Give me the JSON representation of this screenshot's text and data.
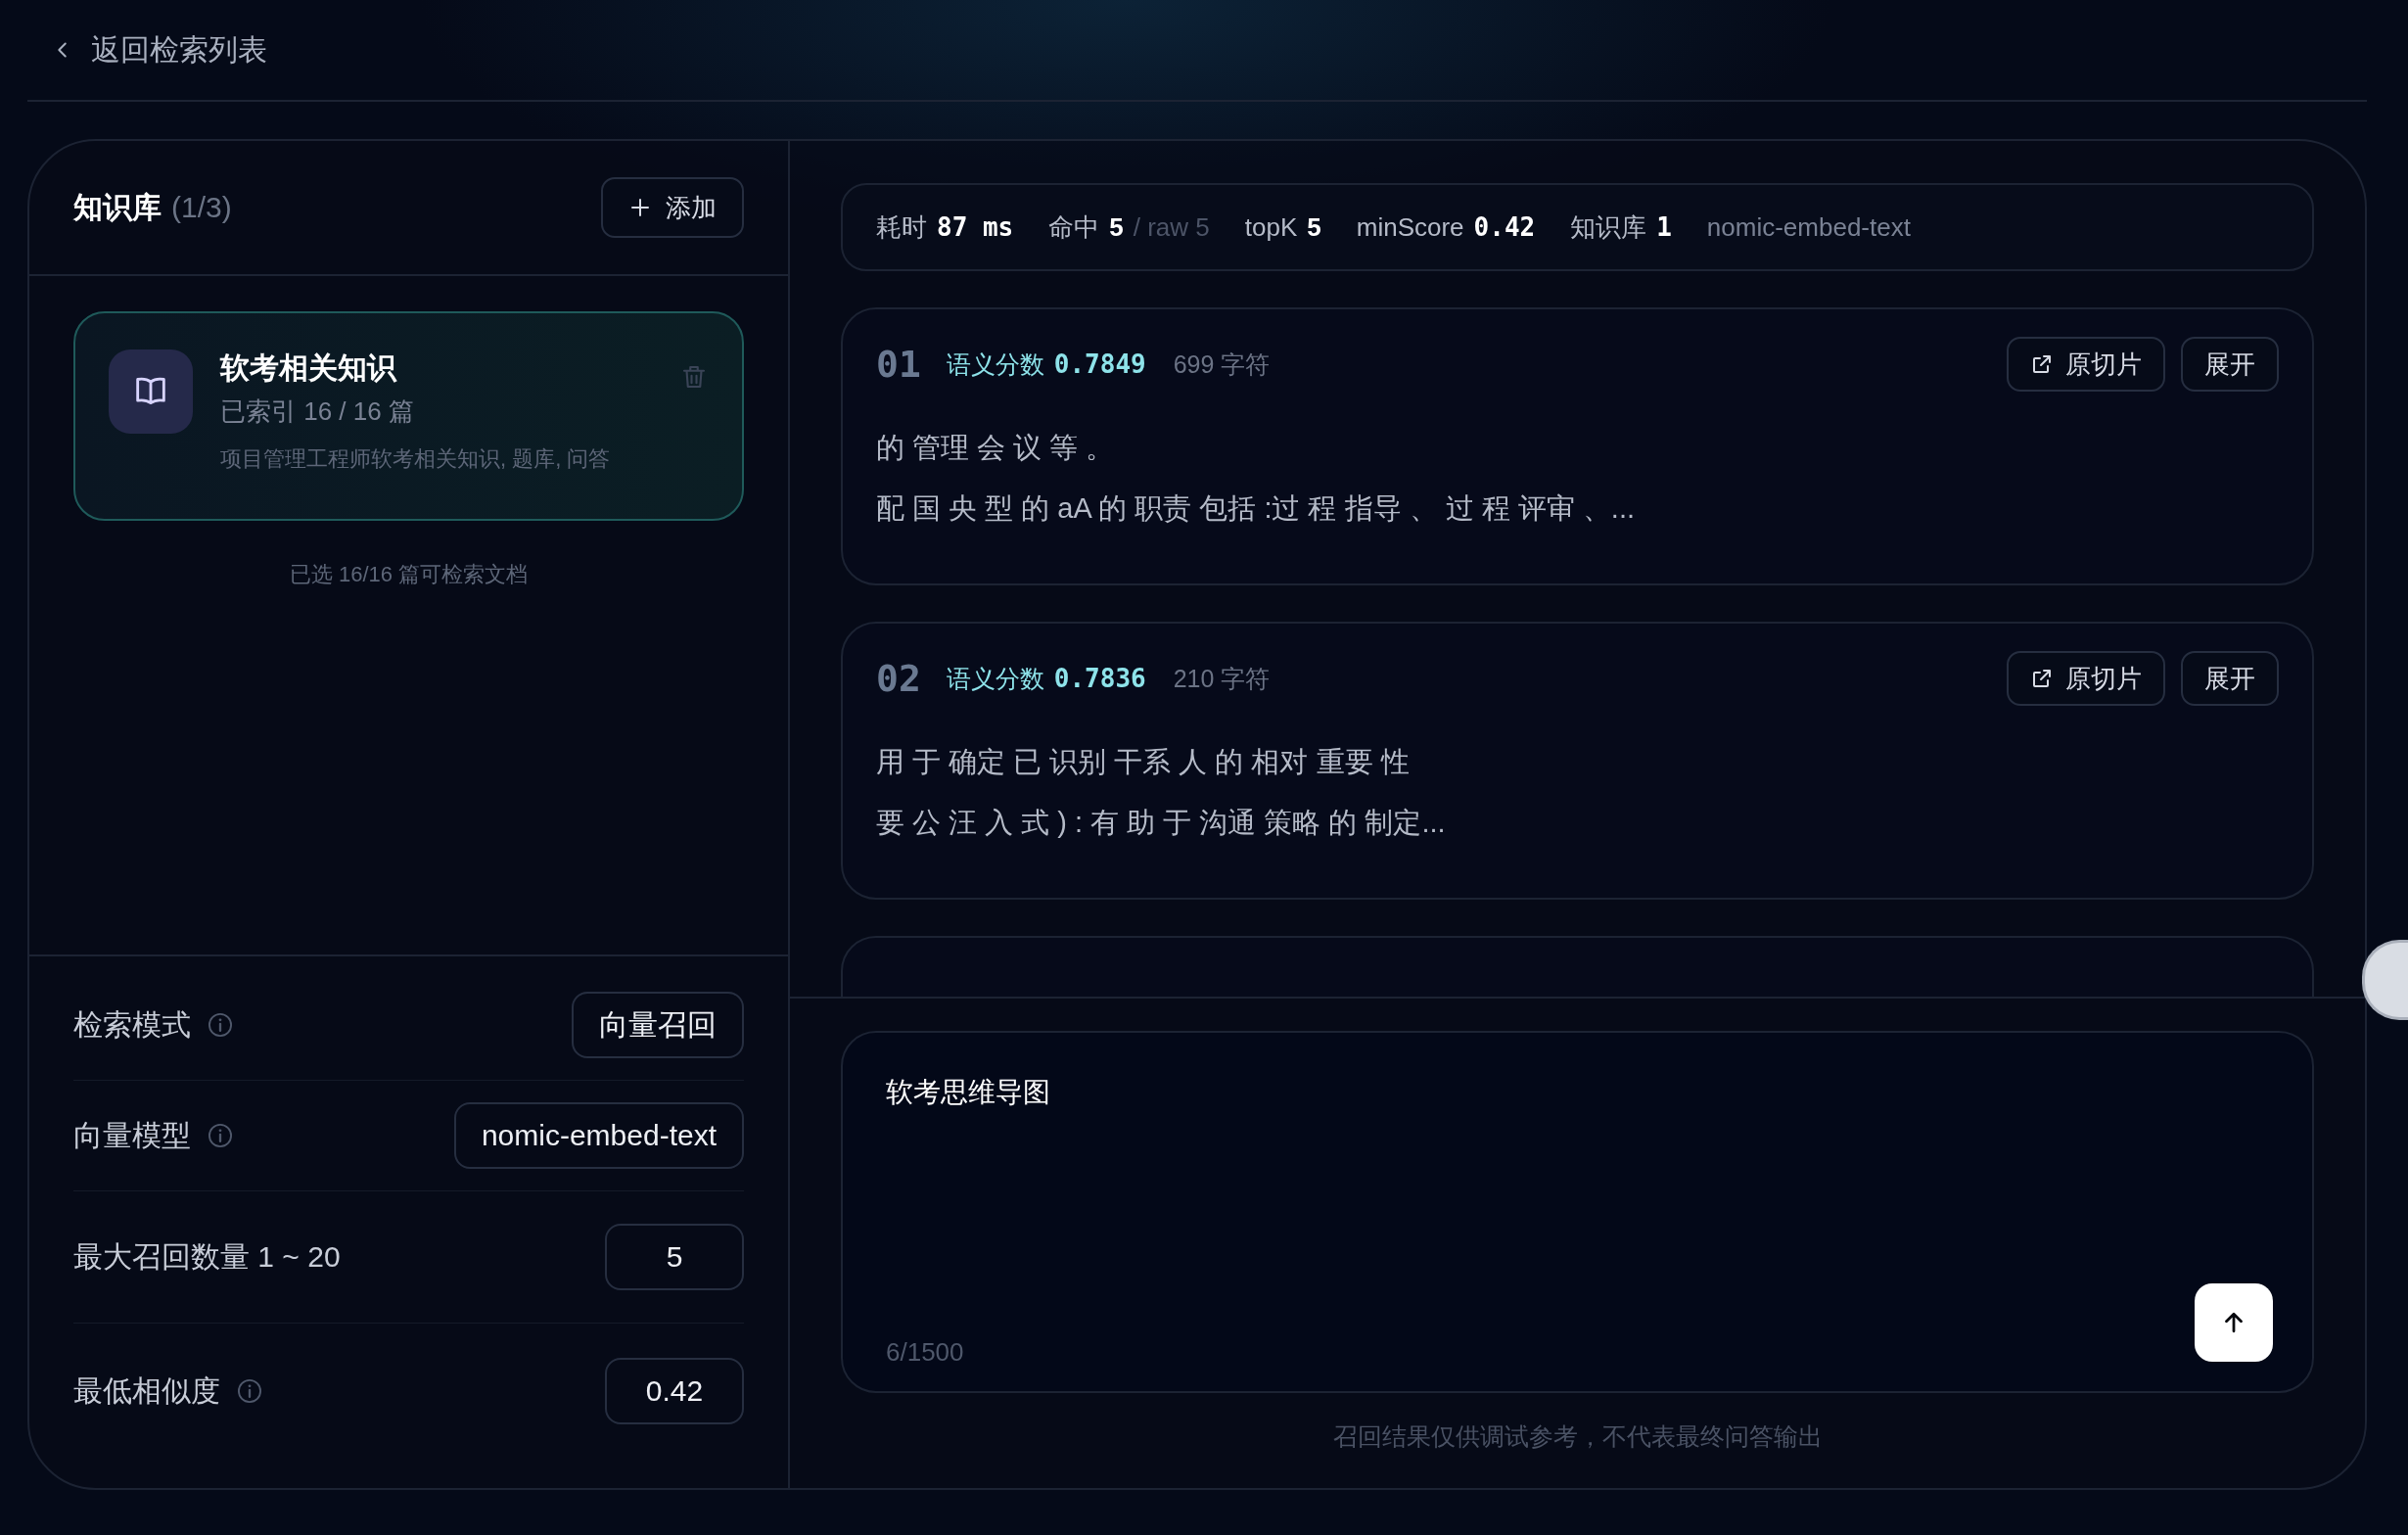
{
  "back_link": {
    "label": "返回检索列表"
  },
  "knowledge_panel": {
    "title": "知识库",
    "count": "(1/3)",
    "add_button": "添加",
    "bases": [
      {
        "name": "软考相关知识",
        "indexed": "已索引 16 / 16 篇",
        "description": "项目管理工程师软考相关知识, 题库, 问答",
        "selected": true
      }
    ],
    "summary": "已选 16/16 篇可检索文档"
  },
  "settings": [
    {
      "label": "检索模式",
      "info": true,
      "value": "向量召回"
    },
    {
      "label": "向量模型",
      "info": true,
      "value": "nomic-embed-text"
    },
    {
      "label": "最大召回数量 1 ~ 20",
      "info": false,
      "value": "5"
    },
    {
      "label": "最低相似度",
      "info": true,
      "value": "0.42"
    }
  ],
  "stats": [
    {
      "label": "耗时",
      "value": "87 ms",
      "mono": true
    },
    {
      "label": "命中",
      "value": "5",
      "mono": false,
      "extra": "/ raw 5"
    },
    {
      "label": "topK",
      "value": "5",
      "mono": false
    },
    {
      "label": "minScore",
      "value": "0.42",
      "mono": true
    },
    {
      "label": "知识库",
      "value": "1",
      "mono": true
    },
    {
      "label": "nomic-embed-text"
    }
  ],
  "results": [
    {
      "kind": "full",
      "rank": "01",
      "score_label": "语义分数",
      "score": "0.7849",
      "length": "699 字符",
      "lines": [
        "的 管理 会 议 等 。",
        "配 国 央 型 的 aA 的 职责 包括 :过 程 指导 、 过 程 评审 、..."
      ],
      "open_button": "原切片",
      "expand_button": "展开"
    },
    {
      "kind": "full",
      "rank": "02",
      "score_label": "语义分数",
      "score": "0.7836",
      "length": "210 字符",
      "lines": [
        "用 于 确定 已 识别 干系 人 的 相对 重要 性",
        "要 公 汪 入 式 ) : 有 助 于 沟通 策略 的 制定..."
      ],
      "open_button": "原切片",
      "expand_button": "展开"
    },
    {
      "kind": "clipped"
    }
  ],
  "query": {
    "value": "软考思维导图",
    "counter": "6/1500"
  },
  "footnote": "召回结果仅供调试参考，不代表最终问答输出"
}
